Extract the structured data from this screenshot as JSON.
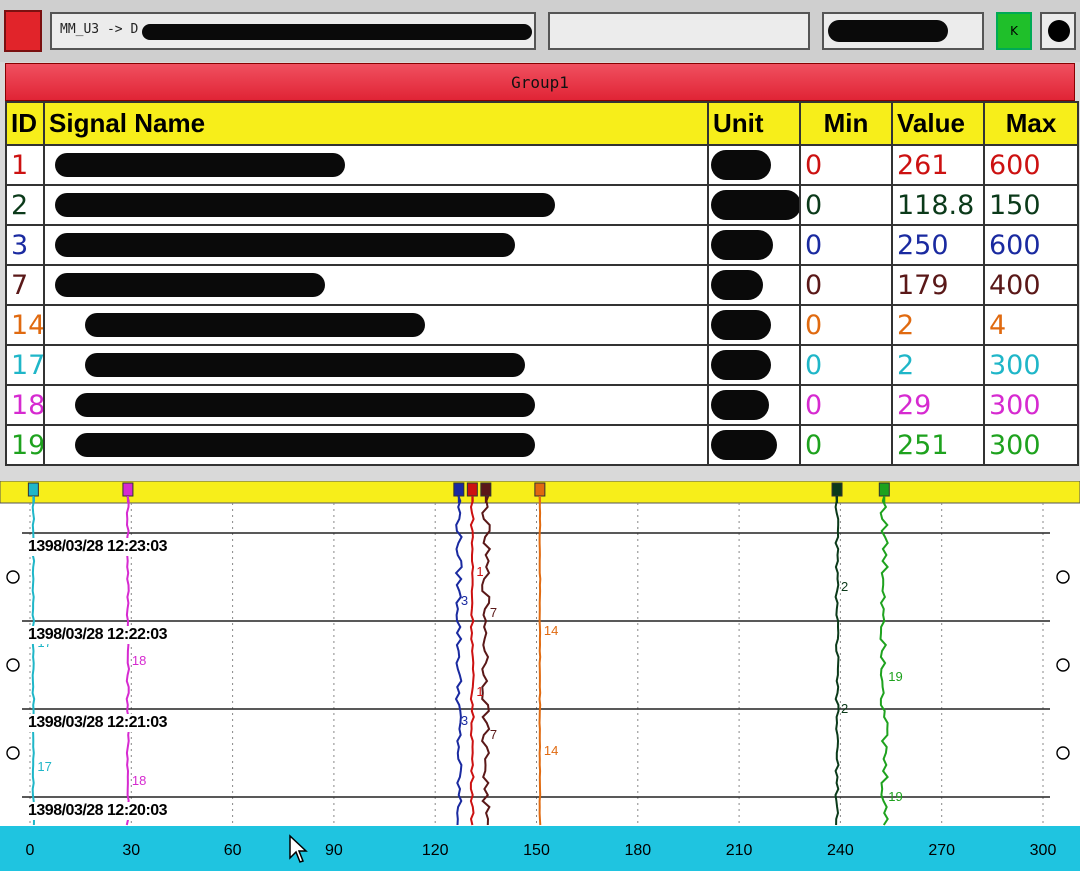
{
  "topbar": {
    "path_text": "MM_U3 -> D",
    "status_k": "K"
  },
  "group": {
    "title": "Group1"
  },
  "table": {
    "headers": {
      "id": "ID",
      "name": "Signal Name",
      "unit": "Unit",
      "min": "Min",
      "value": "Value",
      "max": "Max"
    },
    "rows": [
      {
        "id": "1",
        "color": "#cc1111",
        "min": "0",
        "value": "261",
        "max": "600"
      },
      {
        "id": "2",
        "color": "#0b3a1a",
        "min": "0",
        "value": "118.8",
        "max": "150"
      },
      {
        "id": "3",
        "color": "#1a2aa0",
        "min": "0",
        "value": "250",
        "max": "600"
      },
      {
        "id": "7",
        "color": "#5a1818",
        "min": "0",
        "value": "179",
        "max": "400"
      },
      {
        "id": "14",
        "color": "#e06a10",
        "min": "0",
        "value": "2",
        "max": "4"
      },
      {
        "id": "17",
        "color": "#1fb6c8",
        "min": "0",
        "value": "2",
        "max": "300"
      },
      {
        "id": "18",
        "color": "#d62ad0",
        "min": "0",
        "value": "29",
        "max": "300"
      },
      {
        "id": "19",
        "color": "#1ea21e",
        "min": "0",
        "value": "251",
        "max": "300"
      }
    ]
  },
  "trend": {
    "x_ticks": [
      "0",
      "30",
      "60",
      "90",
      "120",
      "150",
      "180",
      "210",
      "240",
      "270",
      "300"
    ],
    "timestamps": [
      "1398/03/28 12:23:03",
      "1398/03/28 12:22:03",
      "1398/03/28 12:21:03",
      "1398/03/28 12:20:03"
    ],
    "trace_labels": {
      "t1": "1",
      "t2": "2",
      "t3": "3",
      "t7": "7",
      "t14": "14",
      "t17": "17",
      "t18": "18",
      "t19": "19"
    },
    "markers": [
      {
        "id": "17",
        "color": "#1fb6c8",
        "x": 1
      },
      {
        "id": "18",
        "color": "#d62ad0",
        "x": 29
      },
      {
        "id": "3",
        "color": "#1a2aa0",
        "x": 127
      },
      {
        "id": "1",
        "color": "#cc1111",
        "x": 131
      },
      {
        "id": "7",
        "color": "#5a1818",
        "x": 135
      },
      {
        "id": "14",
        "color": "#e06a10",
        "x": 151
      },
      {
        "id": "2",
        "color": "#0b3a1a",
        "x": 239
      },
      {
        "id": "19",
        "color": "#1ea21e",
        "x": 253
      }
    ]
  }
}
